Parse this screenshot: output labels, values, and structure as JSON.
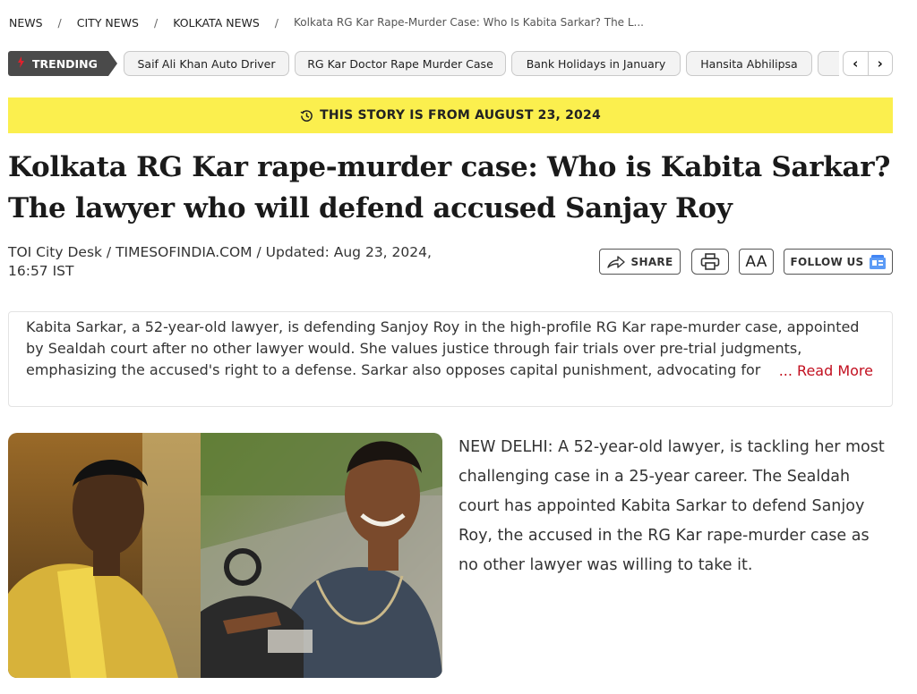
{
  "breadcrumb": {
    "items": [
      "NEWS",
      "CITY NEWS",
      "KOLKATA NEWS"
    ],
    "separator": "/",
    "current": "Kolkata RG Kar Rape-Murder Case: Who Is Kabita Sarkar? The L..."
  },
  "trending": {
    "label": "TRENDING",
    "icon": "flame-icon",
    "pills": [
      "Saif Ali Khan Auto Driver",
      "RG Kar Doctor Rape Murder Case",
      "Bank Holidays in January",
      "Hansita Abhilipsa"
    ],
    "prev_icon": "‹",
    "next_icon": "›"
  },
  "date_banner": {
    "icon": "history-clock-icon",
    "text": "THIS STORY IS FROM AUGUST 23, 2024",
    "color": "#fbef4e"
  },
  "headline": "Kolkata RG Kar rape-murder case: Who is Kabita Sarkar? The lawyer who will defend accused Sanjay Roy",
  "byline": "TOI City Desk / TIMESOFINDIA.COM / Updated: Aug 23, 2024, 16:57 IST",
  "actions": {
    "share_label": "SHARE",
    "share_icon": "share-arrow-icon",
    "print_icon": "printer-icon",
    "font_size_label": "AA",
    "follow_label": "FOLLOW US",
    "follow_icon": "google-news-icon"
  },
  "summary": {
    "text": "Kabita Sarkar, a 52-year-old lawyer, is defending Sanjoy Roy in the high-profile RG Kar rape-murder case, appointed by Sealdah court after no other lawyer would. She values justice through fair trials over pre-trial judgments, emphasizing the accused's right to a defense. Sarkar also opposes capital punishment, advocating for",
    "read_more": "... Read More",
    "read_more_color": "#c20f1f"
  },
  "article": {
    "image_alt": "Photo of the accused",
    "body": "NEW DELHI: A 52-year-old lawyer, is tackling her most challenging case in a 25-year career. The Sealdah court has appointed Kabita Sarkar to defend Sanjoy Roy, the accused in the RG Kar rape-murder case as no other lawyer was willing to take it."
  }
}
